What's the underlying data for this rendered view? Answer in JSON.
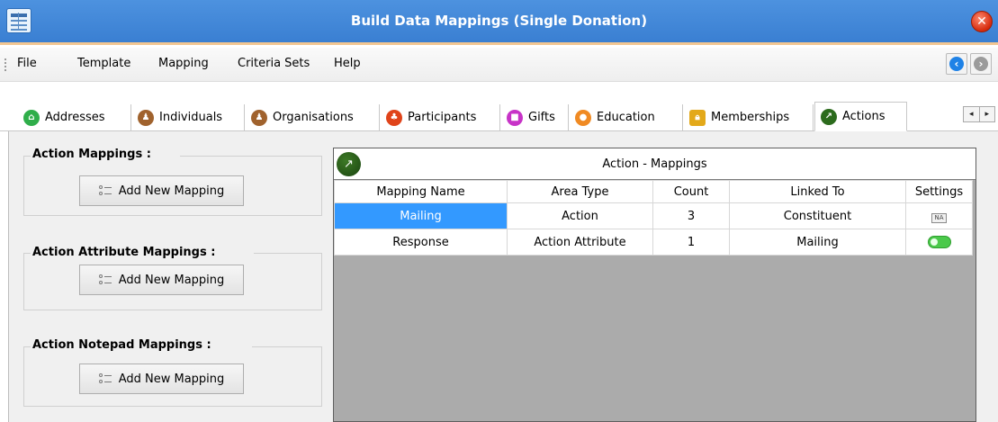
{
  "window": {
    "title": "Build Data Mappings (Single Donation)"
  },
  "menu": {
    "items": [
      "File",
      "Template",
      "Mapping",
      "Criteria Sets",
      "Help"
    ]
  },
  "tabs": [
    {
      "label": "Addresses",
      "icon": "addresses-icon",
      "color": "#2fae4a"
    },
    {
      "label": "Individuals",
      "icon": "individuals-icon",
      "color": "#a0622d"
    },
    {
      "label": "Organisations",
      "icon": "organisations-icon",
      "color": "#a0622d"
    },
    {
      "label": "Participants",
      "icon": "participants-icon",
      "color": "#e0441a"
    },
    {
      "label": "Gifts",
      "icon": "gifts-icon",
      "color": "#c733c7"
    },
    {
      "label": "Education",
      "icon": "education-icon",
      "color": "#f08a23"
    },
    {
      "label": "Memberships",
      "icon": "lock-icon",
      "color": "#e3a91a"
    },
    {
      "label": "Actions",
      "icon": "actions-icon",
      "color": "#2c6b1d",
      "active": true
    }
  ],
  "groups": [
    {
      "title": "Action Mappings :",
      "button": "Add New Mapping"
    },
    {
      "title": "Action Attribute Mappings :",
      "button": "Add New Mapping"
    },
    {
      "title": "Action Notepad Mappings :",
      "button": "Add New Mapping"
    }
  ],
  "grid": {
    "title": "Action - Mappings",
    "columns": [
      "Mapping Name",
      "Area Type",
      "Count",
      "Linked To",
      "Settings"
    ],
    "rows": [
      {
        "name": "Mailing",
        "area": "Action",
        "count": "3",
        "linked": "Constituent",
        "settings": "NA",
        "selected": true
      },
      {
        "name": "Response",
        "area": "Action Attribute",
        "count": "1",
        "linked": "Mailing",
        "settings": "toggle-on"
      }
    ]
  },
  "colors": {
    "titlebar": "#4189da",
    "selection": "#3399ff",
    "grid_background": "#ababab"
  }
}
